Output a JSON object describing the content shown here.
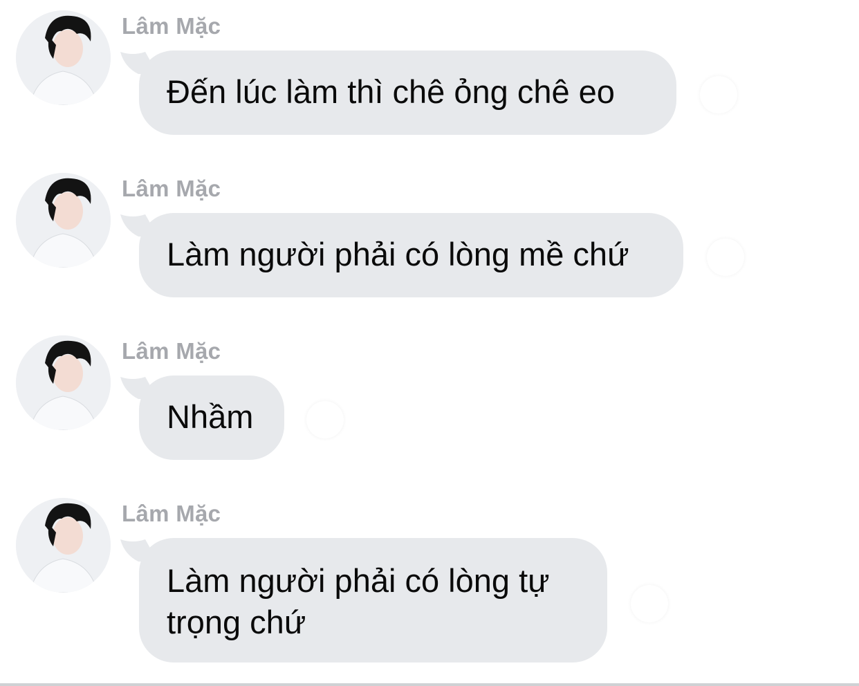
{
  "messages": [
    {
      "sender": "Lâm Mặc",
      "text": "Đến lúc làm thì chê ỏng chê eo"
    },
    {
      "sender": "Lâm Mặc",
      "text": "Làm người phải có lòng mề chứ"
    },
    {
      "sender": "Lâm Mặc",
      "text": "Nhầm"
    },
    {
      "sender": "Lâm Mặc",
      "line1": "Làm người phải có lòng tự",
      "line2": "trọng chứ"
    }
  ],
  "colors": {
    "bubble": "#e7e9ec",
    "sender": "#a6a8ad",
    "text": "#0a0a0a"
  },
  "icons": {
    "avatar": "profile-photo",
    "read_receipt": "seen-indicator"
  }
}
